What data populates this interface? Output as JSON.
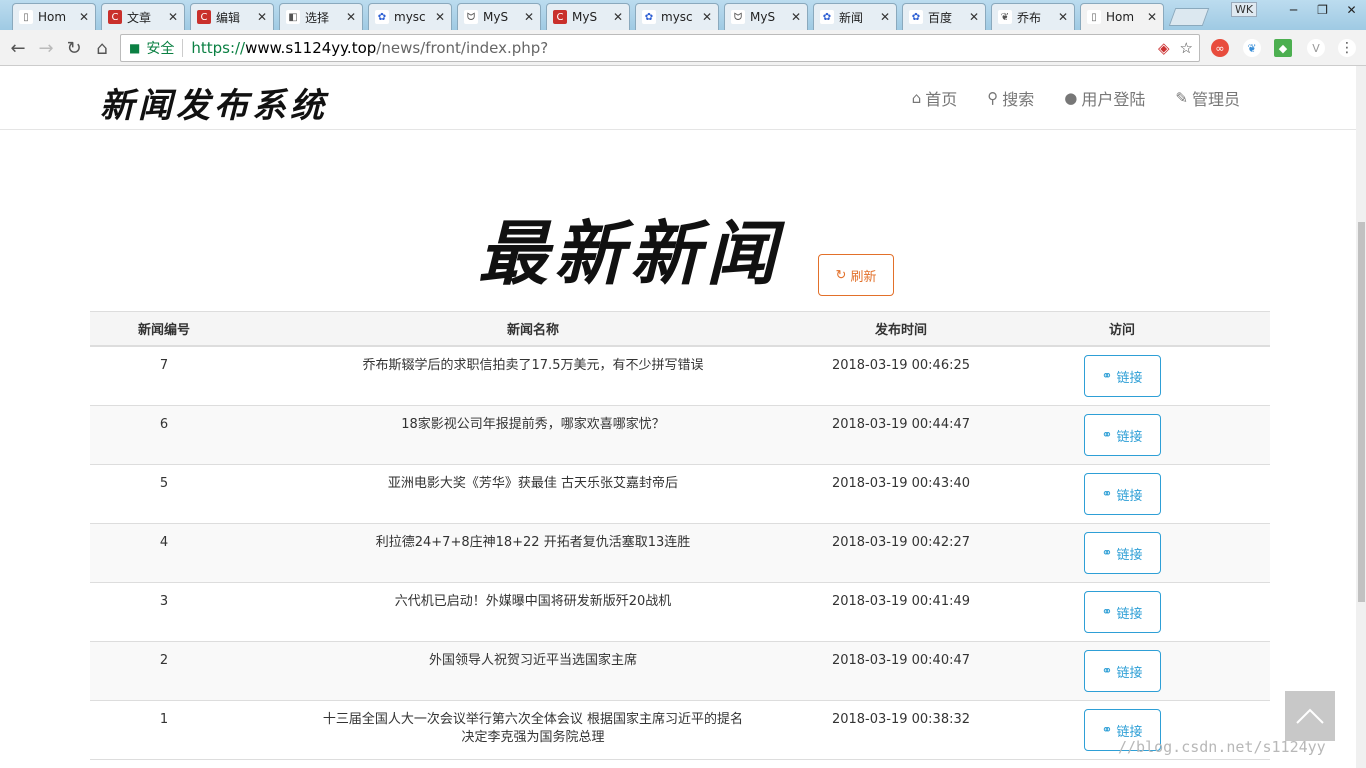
{
  "browser": {
    "tabs": [
      {
        "label": "Hom",
        "icon": "page-icon"
      },
      {
        "label": "文章",
        "icon": "csdn-icon"
      },
      {
        "label": "编辑",
        "icon": "csdn-icon"
      },
      {
        "label": "选择",
        "icon": "puzzle-icon"
      },
      {
        "label": "mysc",
        "icon": "baidu-icon"
      },
      {
        "label": "MyS",
        "icon": "mysql-icon"
      },
      {
        "label": "MyS",
        "icon": "csdn-icon"
      },
      {
        "label": "mysc",
        "icon": "baidu-icon"
      },
      {
        "label": "MyS",
        "icon": "mysql-icon"
      },
      {
        "label": "新闻",
        "icon": "baidu-icon"
      },
      {
        "label": "百度",
        "icon": "baidu-icon"
      },
      {
        "label": "乔布",
        "icon": "news-icon"
      },
      {
        "label": "Hom",
        "icon": "page-icon"
      }
    ],
    "wk_label": "WK",
    "secure_label": "安全",
    "url_scheme": "https://",
    "url_host": "www.s1124yy.top",
    "url_path": "/news/front/index.php?"
  },
  "navbar": {
    "brand": "新闻发布系统",
    "links": [
      {
        "label": "首页",
        "icon": "home-icon",
        "glyph": "⌂"
      },
      {
        "label": "搜索",
        "icon": "search-icon",
        "glyph": "⚲"
      },
      {
        "label": "用户登陆",
        "icon": "user-icon",
        "glyph": "●"
      },
      {
        "label": "管理员",
        "icon": "wrench-icon",
        "glyph": "✎"
      }
    ]
  },
  "main": {
    "heading": "最新新闻",
    "refresh_label": "刷新",
    "table": {
      "headers": [
        "新闻编号",
        "新闻名称",
        "发布时间",
        "访问"
      ],
      "link_label": "链接",
      "rows": [
        {
          "id": "7",
          "title": "乔布斯辍学后的求职信拍卖了17.5万美元，有不少拼写错误",
          "time": "2018-03-19 00:46:25"
        },
        {
          "id": "6",
          "title": "18家影视公司年报提前秀，哪家欢喜哪家忧？",
          "time": "2018-03-19 00:44:47"
        },
        {
          "id": "5",
          "title": "亚洲电影大奖《芳华》获最佳 古天乐张艾嘉封帝后",
          "time": "2018-03-19 00:43:40"
        },
        {
          "id": "4",
          "title": "利拉德24+7+8庄神18+22 开拓者复仇活塞取13连胜",
          "time": "2018-03-19 00:42:27"
        },
        {
          "id": "3",
          "title": "六代机已启动！外媒曝中国将研发新版歼20战机",
          "time": "2018-03-19 00:41:49"
        },
        {
          "id": "2",
          "title": "外国领导人祝贺习近平当选国家主席",
          "time": "2018-03-19 00:40:47"
        },
        {
          "id": "1",
          "title": "十三届全国人大一次会议举行第六次全体会议 根据国家主席习近平的提名决定李克强为国务院总理",
          "time": "2018-03-19 00:38:32"
        }
      ]
    }
  },
  "watermark": "//blog.csdn.net/s1124yy",
  "colors": {
    "accent_orange": "#e2702a",
    "link_blue": "#2e9fd6",
    "secure_green": "#0b8043"
  }
}
